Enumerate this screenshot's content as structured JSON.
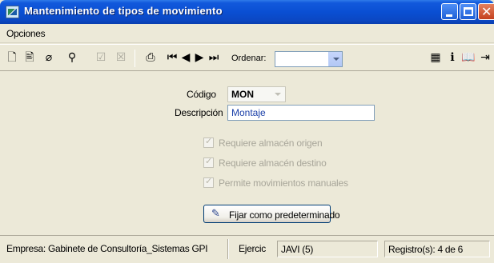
{
  "window": {
    "title": "Mantenimiento de tipos de movimiento"
  },
  "menu": {
    "items": [
      "Opciones"
    ]
  },
  "toolbar": {
    "icons": [
      {
        "name": "new-document-icon",
        "glyph": "🗋",
        "enabled": true
      },
      {
        "name": "edit-document-icon",
        "glyph": "🖹",
        "enabled": true
      },
      {
        "name": "eraser-icon",
        "glyph": "⌀",
        "enabled": true
      },
      {
        "name": "binoculars-icon",
        "glyph": "⚲",
        "enabled": true
      },
      {
        "name": "accept-icon",
        "glyph": "☑",
        "enabled": false
      },
      {
        "name": "cancel-icon",
        "glyph": "☒",
        "enabled": false
      },
      {
        "name": "print-icon",
        "glyph": "⎙",
        "enabled": true
      },
      {
        "name": "first-record-icon",
        "glyph": "⏮",
        "enabled": true
      },
      {
        "name": "previous-record-icon",
        "glyph": "◀",
        "enabled": true
      },
      {
        "name": "next-record-icon",
        "glyph": "▶",
        "enabled": true
      },
      {
        "name": "last-record-icon",
        "glyph": "⏭",
        "enabled": true
      },
      {
        "name": "calculator-icon",
        "glyph": "▦",
        "enabled": true
      },
      {
        "name": "info-icon",
        "glyph": "ℹ",
        "enabled": true
      },
      {
        "name": "help-book-icon",
        "glyph": "📖",
        "enabled": true
      },
      {
        "name": "exit-icon",
        "glyph": "⇥",
        "enabled": true
      }
    ],
    "ordenar_label": "Ordenar:",
    "ordenar_value": ""
  },
  "form": {
    "codigo_label": "Código",
    "codigo_value": "MON",
    "descripcion_label": "Descripción",
    "descripcion_value": "Montaje",
    "checkboxes": [
      {
        "label": "Requiere almacén origen",
        "checked": true,
        "enabled": false
      },
      {
        "label": "Requiere almacén destino",
        "checked": true,
        "enabled": false
      },
      {
        "label": "Permite movimientos manuales",
        "checked": true,
        "enabled": false
      }
    ],
    "fix_button_label": "Fijar como predeterminado"
  },
  "status": {
    "empresa": "Empresa: Gabinete de Consultoría_Sistemas GPI",
    "ejercicio_label": "Ejercic",
    "ejercicio_value": "JAVI  (5)",
    "registros": "Registro(s): 4 de 6"
  },
  "colors": {
    "titlebar": "#0a4fd3",
    "window_bg": "#ece9d8",
    "field_border": "#7f9db9",
    "description_text": "#1a3fa8"
  }
}
